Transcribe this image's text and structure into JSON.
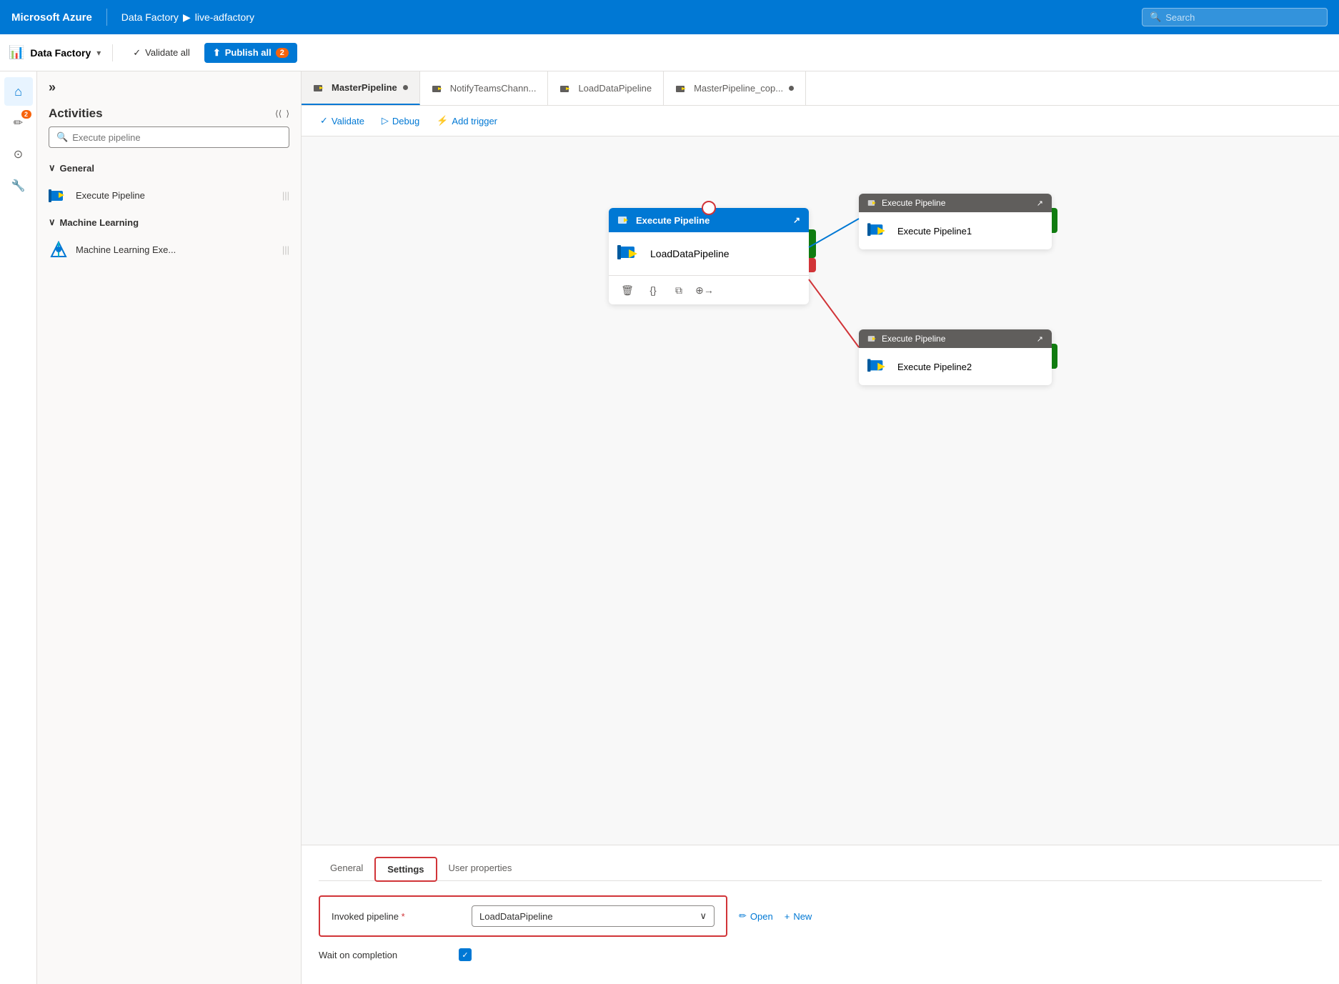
{
  "brand": "Microsoft Azure",
  "topbar": {
    "breadcrumb_factory": "Data Factory",
    "breadcrumb_arrow": "▶",
    "breadcrumb_instance": "live-adfactory",
    "search_placeholder": "Search"
  },
  "toolbar": {
    "factory_label": "Data Factory",
    "validate_label": "Validate all",
    "publish_label": "Publish all",
    "publish_badge": "2"
  },
  "tabs": [
    {
      "id": "master",
      "label": "MasterPipeline",
      "active": true,
      "dot": true
    },
    {
      "id": "notify",
      "label": "NotifyTeamsChann...",
      "active": false,
      "dot": false
    },
    {
      "id": "load",
      "label": "LoadDataPipeline",
      "active": false,
      "dot": false
    },
    {
      "id": "mastercopy",
      "label": "MasterPipeline_cop...",
      "active": false,
      "dot": true
    }
  ],
  "pipeline_toolbar": {
    "validate_label": "Validate",
    "debug_label": "Debug",
    "add_trigger_label": "Add trigger"
  },
  "activities": {
    "title": "Activities",
    "search_placeholder": "Execute pipeline",
    "sections": [
      {
        "label": "General",
        "items": [
          {
            "label": "Execute Pipeline"
          }
        ]
      },
      {
        "label": "Machine Learning",
        "items": [
          {
            "label": "Machine Learning Exe..."
          }
        ]
      }
    ]
  },
  "canvas": {
    "main_card": {
      "header": "Execute Pipeline",
      "body_label": "LoadDataPipeline"
    },
    "right_card_1": {
      "header": "Execute Pipeline",
      "body_label": "Execute Pipeline1"
    },
    "right_card_2": {
      "header": "Execute Pipeline",
      "body_label": "Execute Pipeline2"
    }
  },
  "bottom_panel": {
    "tabs": [
      {
        "label": "General",
        "active": false
      },
      {
        "label": "Settings",
        "active": true,
        "highlighted": true
      },
      {
        "label": "User properties",
        "active": false
      }
    ],
    "invoked_label": "Invoked pipeline",
    "invoked_required": "*",
    "invoked_value": "LoadDataPipeline",
    "open_label": "Open",
    "new_label": "New",
    "wait_label": "Wait on completion",
    "wait_checked": true
  },
  "sidebar_icons": [
    {
      "name": "home",
      "symbol": "⌂",
      "active": true
    },
    {
      "name": "edit",
      "symbol": "✏",
      "active": false,
      "badge": "2"
    },
    {
      "name": "monitor",
      "symbol": "⊙",
      "active": false
    },
    {
      "name": "manage",
      "symbol": "🔧",
      "active": false
    }
  ]
}
